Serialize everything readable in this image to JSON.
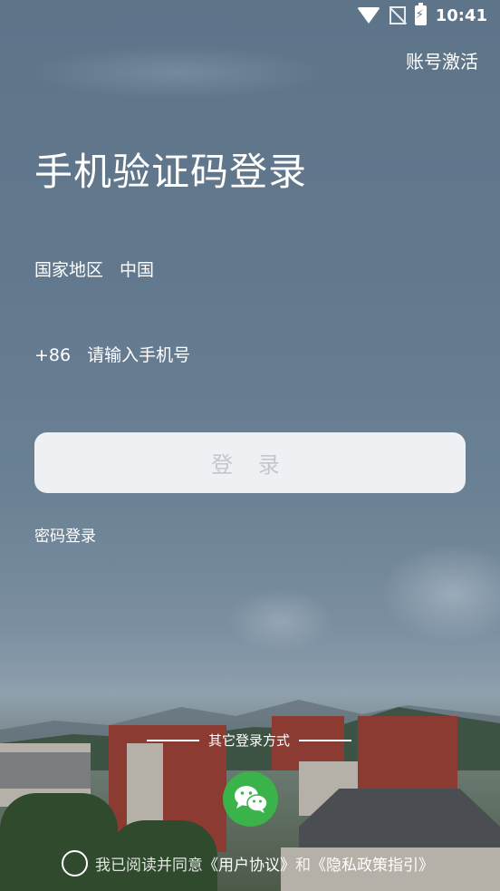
{
  "status_bar": {
    "time": "10:41",
    "icons": [
      "wifi-icon",
      "no-sim-icon",
      "battery-charging-icon"
    ]
  },
  "header": {
    "activate_label": "账号激活"
  },
  "title": "手机验证码登录",
  "region": {
    "label": "国家地区",
    "value": "中国"
  },
  "phone": {
    "prefix": "+86",
    "placeholder": "请输入手机号",
    "value": ""
  },
  "login_button_label": "登 录",
  "password_login_label": "密码登录",
  "other_login": {
    "label": "其它登录方式",
    "methods": [
      "wechat-icon"
    ]
  },
  "agreement": {
    "prefix": "我已阅读并同意",
    "user_agreement": "《用户协议》",
    "conjunction": "和",
    "privacy_policy": "《隐私政策指引》",
    "checked": false
  },
  "colors": {
    "wechat_green": "#3ab34a",
    "button_bg": "#f4f5f8",
    "button_text": "#c3c6cc"
  }
}
